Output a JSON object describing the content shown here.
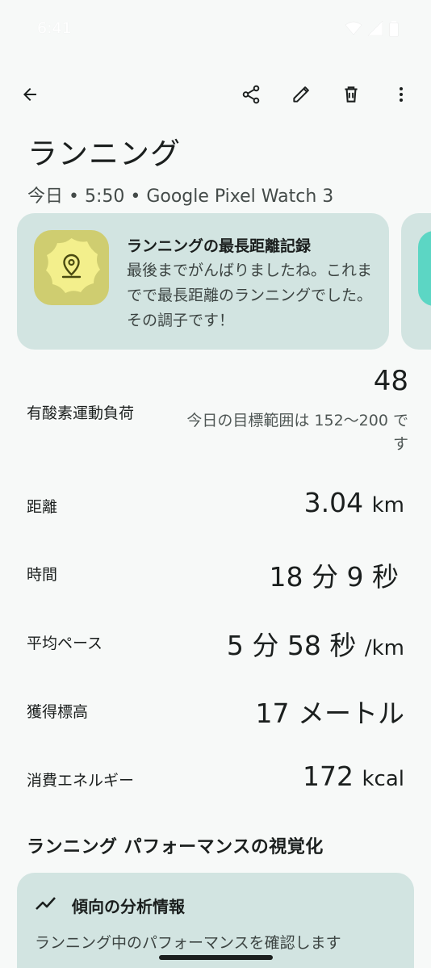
{
  "status_bar": {
    "time": "6:41"
  },
  "header": {
    "title": "ランニング",
    "subtitle": "今日 • 5:50 • Google Pixel Watch 3"
  },
  "achievement": {
    "title": "ランニングの最長距離記録",
    "body": "最後までがんばりましたね。これまでで最長距離のランニングでした。その調子です！",
    "badge_icon": "location-pin-icon",
    "badge_color": "#f3ef8c"
  },
  "metrics": {
    "cardio_load": {
      "label": "有酸素運動負荷",
      "value": "48",
      "target": "今日の目標範囲は 152〜200 です"
    },
    "distance": {
      "label": "距離",
      "value": "3.04",
      "unit": "km"
    },
    "duration": {
      "label": "時間",
      "value": "18 分 9 秒"
    },
    "pace": {
      "label": "平均ペース",
      "value": "5 分 58 秒",
      "unit": "/km"
    },
    "elevation": {
      "label": "獲得標高",
      "value": "17 メートル"
    },
    "energy": {
      "label": "消費エネルギー",
      "value": "172",
      "unit": "kcal"
    }
  },
  "section": {
    "heading": "ランニング パフォーマンスの視覚化"
  },
  "insights": {
    "title": "傾向の分析情報",
    "description": "ランニング中のパフォーマンスを確認します"
  },
  "colors": {
    "card_bg": "#d2e4e1",
    "page_bg": "#f7f9f8",
    "accent_next": "#5cd6c4"
  }
}
